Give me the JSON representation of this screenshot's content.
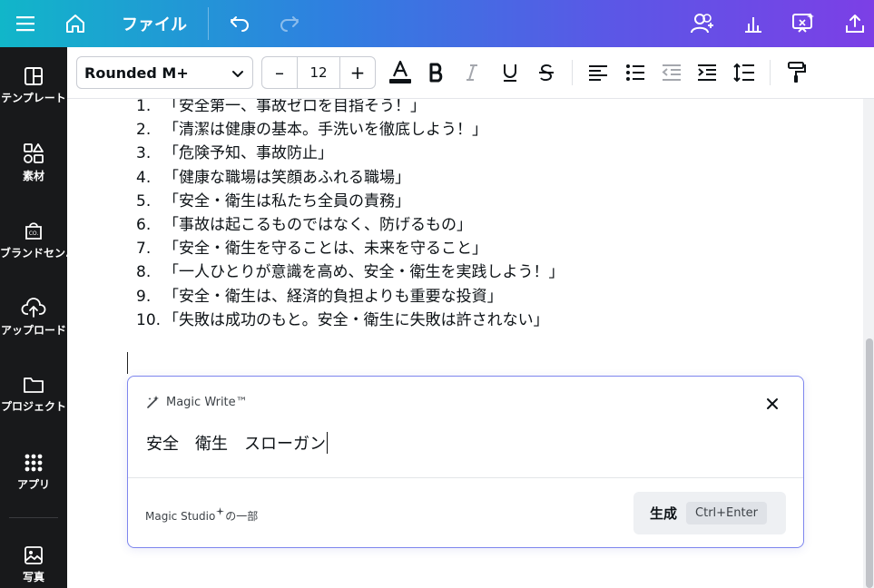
{
  "topbar": {
    "file_label": "ファイル",
    "icons": [
      "menu-icon",
      "home-icon",
      "undo-icon",
      "redo-icon",
      "share-people-icon",
      "insights-icon",
      "present-icon",
      "upload-share-icon"
    ]
  },
  "sidebar": {
    "items": [
      {
        "label": "テンプレート",
        "icon": "templates-icon"
      },
      {
        "label": "素材",
        "icon": "elements-icon"
      },
      {
        "label": "ブランドセン...",
        "icon": "brand-icon"
      },
      {
        "label": "アップロード",
        "icon": "upload-icon"
      },
      {
        "label": "プロジェクト",
        "icon": "folder-icon"
      },
      {
        "label": "アプリ",
        "icon": "apps-icon"
      },
      {
        "label": "写真",
        "icon": "photo-icon"
      }
    ]
  },
  "toolbar": {
    "font_name": "Rounded M+",
    "font_size": "12",
    "minus": "–",
    "plus": "+"
  },
  "content": {
    "slogans": [
      {
        "num": "1.",
        "text": "「安全第一、事故ゼロを目指そう！」"
      },
      {
        "num": "2.",
        "text": "「清潔は健康の基本。手洗いを徹底しよう！」"
      },
      {
        "num": "3.",
        "text": "「危険予知、事故防止」"
      },
      {
        "num": "4.",
        "text": "「健康な職場は笑顔あふれる職場」"
      },
      {
        "num": "5.",
        "text": "「安全・衛生は私たち全員の責務」"
      },
      {
        "num": "6.",
        "text": "「事故は起こるものではなく、防げるもの」"
      },
      {
        "num": "7.",
        "text": "「安全・衛生を守ることは、未来を守ること」"
      },
      {
        "num": "8.",
        "text": "「一人ひとりが意識を高め、安全・衛生を実践しよう！」"
      },
      {
        "num": "9.",
        "text": "「安全・衛生は、経済的負担よりも重要な投資」"
      },
      {
        "num": "10.",
        "text": "「失敗は成功のもと。安全・衛生に失敗は許されない」"
      }
    ]
  },
  "magic_write": {
    "title": "Magic Write™",
    "prompt": "安全　衛生　スローガン",
    "footer_brand": "Magic Studio",
    "footer_suffix": "の一部",
    "generate_label": "生成",
    "generate_shortcut": "Ctrl+Enter"
  }
}
